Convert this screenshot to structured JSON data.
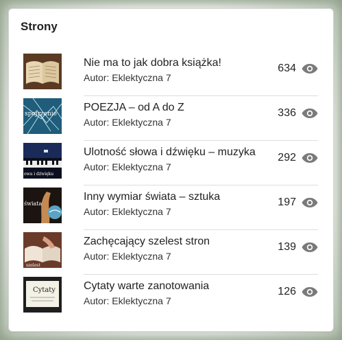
{
  "widget": {
    "title": "Strony"
  },
  "posts": [
    {
      "title": "Nie ma to jak dobra książka!",
      "author": "Autor: Eklektyczna 7",
      "views": "634",
      "thumb": "open-book-icon",
      "thumb_text": ""
    },
    {
      "title": "POEZJA – od A do Z",
      "author": "Autor: Eklektyczna 7",
      "views": "336",
      "thumb": "abstract-poetry-icon",
      "thumb_text": "spojrzenie"
    },
    {
      "title": "Ulotność słowa i dźwięku – muzyka",
      "author": "Autor: Eklektyczna 7",
      "views": "292",
      "thumb": "piano-icon",
      "thumb_text": "owa i dźwięku"
    },
    {
      "title": "Inny wymiar świata – sztuka",
      "author": "Autor: Eklektyczna 7",
      "views": "197",
      "thumb": "art-hands-icon",
      "thumb_text": "świata"
    },
    {
      "title": "Zachęcający szelest stron",
      "author": "Autor: Eklektyczna 7",
      "views": "139",
      "thumb": "reading-book-icon",
      "thumb_text": "szelest"
    },
    {
      "title": "Cytaty warte zanotowania",
      "author": "Autor: Eklektyczna 7",
      "views": "126",
      "thumb": "quotes-card-icon",
      "thumb_text": "Cytaty"
    }
  ],
  "colors": {
    "eye": "#7a7a7a",
    "divider": "#dddddd"
  }
}
